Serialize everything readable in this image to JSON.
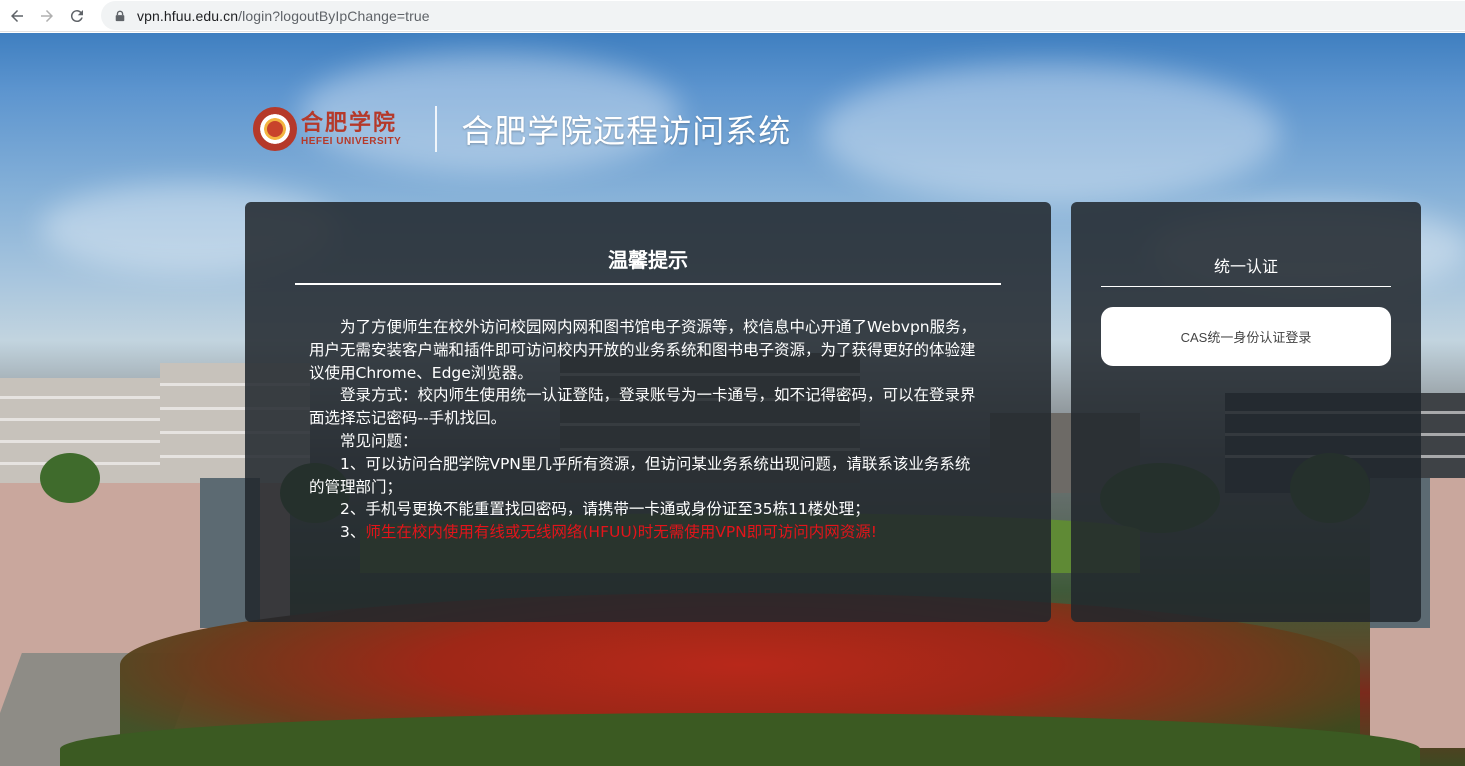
{
  "browser": {
    "url_host": "vpn.hfuu.edu.cn",
    "url_path": "/login?logoutByIpChange=true"
  },
  "header": {
    "logo_cn": "合肥学院",
    "logo_en": "HEFEI UNIVERSITY",
    "title": "合肥学院远程访问系统"
  },
  "notice": {
    "title": "温馨提示",
    "paragraphs": [
      "为了方便师生在校外访问校园网内网和图书馆电子资源等，校信息中心开通了Webvpn服务，用户无需安装客户端和插件即可访问校内开放的业务系统和图书电子资源，为了获得更好的体验建议使用Chrome、Edge浏览器。",
      "登录方式：校内师生使用统一认证登陆，登录账号为一卡通号，如不记得密码，可以在登录界面选择忘记密码--手机找回。",
      "常见问题：",
      "1、可以访问合肥学院VPN里几乎所有资源，但访问某业务系统出现问题，请联系该业务系统的管理部门；",
      "2、手机号更换不能重置找回密码，请携带一卡通或身份证至35栋11楼处理；"
    ],
    "item3_prefix": "3、",
    "item3_warning": "师生在校内使用有线或无线网络(HFUU)时无需使用VPN即可访问内网资源!"
  },
  "auth": {
    "title": "统一认证",
    "cas_button": "CAS统一身份认证登录"
  },
  "colors": {
    "panel_bg": "#21262c",
    "warning": "#e3141a",
    "brand": "#b5392a"
  }
}
